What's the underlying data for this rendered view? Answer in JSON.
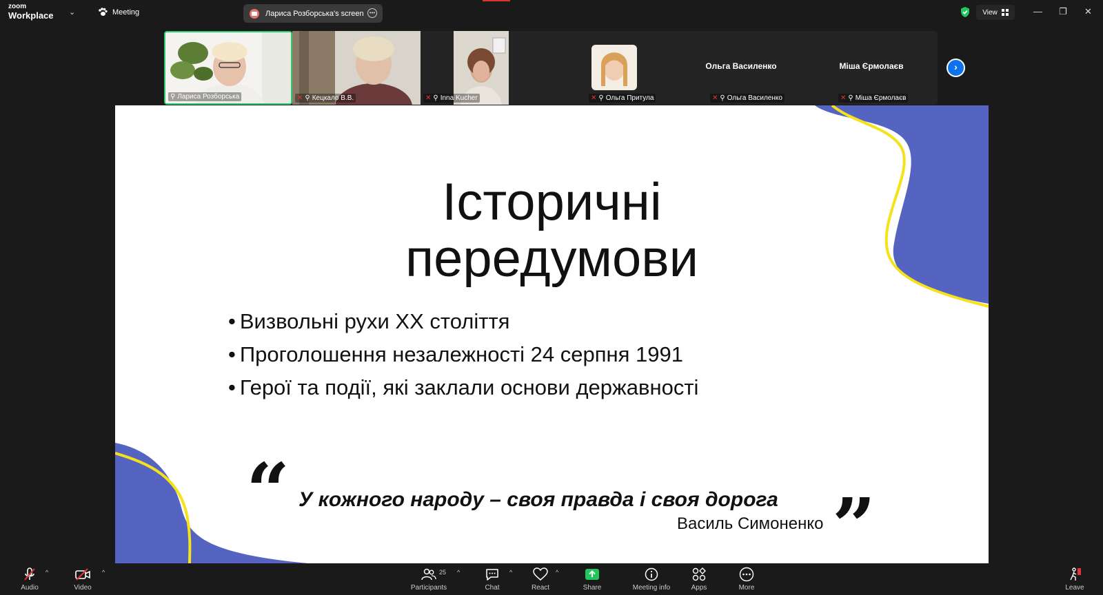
{
  "titlebar": {
    "brand_top": "zoom",
    "brand_bottom": "Workplace",
    "meeting_label": "Meeting",
    "screen_tab_label": "Лариса Розборська's screen",
    "view_label": "View"
  },
  "gallery": {
    "participants": [
      {
        "name": "Лариса Розборська",
        "muted": false,
        "active": true
      },
      {
        "name": "Кецкало В.В.",
        "muted": true
      },
      {
        "name": "Inna Kucher",
        "muted": true
      },
      {
        "name": "Ольга Притула",
        "muted": true
      },
      {
        "name": "Ольга Василенко",
        "muted": true,
        "display_name": "Ольга Василенко"
      },
      {
        "name": "Міша Єрмолаєв",
        "muted": true,
        "display_name": "Міша Єрмолаєв"
      }
    ]
  },
  "slide": {
    "title_line1": "Історичні",
    "title_line2": "передумови",
    "bullets": [
      "Визвольні рухи XX століття",
      "Проголошення незалежності 24 серпня 1991",
      "Герої та події, які заклали основи державності"
    ],
    "quote": "У кожного народу – своя правда і своя дорога",
    "quote_author": "Василь Симоненко",
    "colors": {
      "accent_blue": "#5563c1",
      "accent_yellow": "#f5e21a"
    }
  },
  "toolbar": {
    "audio": "Audio",
    "video": "Video",
    "participants": "Participants",
    "participants_count": "25",
    "chat": "Chat",
    "react": "React",
    "share": "Share",
    "meeting_info": "Meeting info",
    "apps": "Apps",
    "more": "More",
    "leave": "Leave",
    "colors": {
      "share_green": "#22c55e",
      "muted_red": "#e0363b"
    }
  }
}
